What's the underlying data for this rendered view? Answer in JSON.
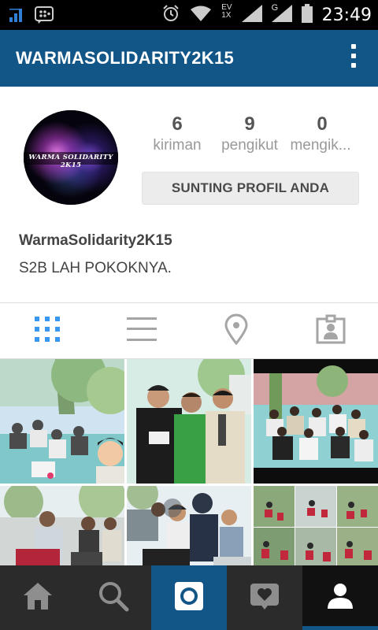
{
  "status_bar": {
    "time": "23:49",
    "network_label": "EV\n1X",
    "network_label_top": "EV",
    "network_label_bottom": "1X",
    "g_label": "G"
  },
  "header": {
    "title": "WARMASOLIDARITY2K15"
  },
  "profile": {
    "avatar_text": "WARMA SOLIDARITY 2K15",
    "stats": [
      {
        "value": "6",
        "label": "kiriman"
      },
      {
        "value": "9",
        "label": "pengikut"
      },
      {
        "value": "0",
        "label": "mengik..."
      }
    ],
    "edit_button_label": "SUNTING PROFIL ANDA",
    "name": "WarmaSolidarity2K15",
    "bio": "S2B LAH POKOKNYA."
  },
  "tabs": [
    {
      "icon": "grid-icon",
      "active": true
    },
    {
      "icon": "list-icon",
      "active": false
    },
    {
      "icon": "location-pin-icon",
      "active": false
    },
    {
      "icon": "tagged-photos-icon",
      "active": false
    }
  ],
  "photos": [
    {
      "name": "photo-1"
    },
    {
      "name": "photo-2"
    },
    {
      "name": "photo-3"
    },
    {
      "name": "photo-4"
    },
    {
      "name": "photo-5"
    },
    {
      "name": "photo-6"
    }
  ],
  "bottom_nav": [
    {
      "icon": "home-icon"
    },
    {
      "icon": "search-icon"
    },
    {
      "icon": "camera-icon"
    },
    {
      "icon": "activity-heart-icon"
    },
    {
      "icon": "profile-icon"
    }
  ],
  "colors": {
    "brand_blue": "#125688",
    "accent_blue": "#3897f0",
    "nav_dark": "#2b2b2b"
  }
}
